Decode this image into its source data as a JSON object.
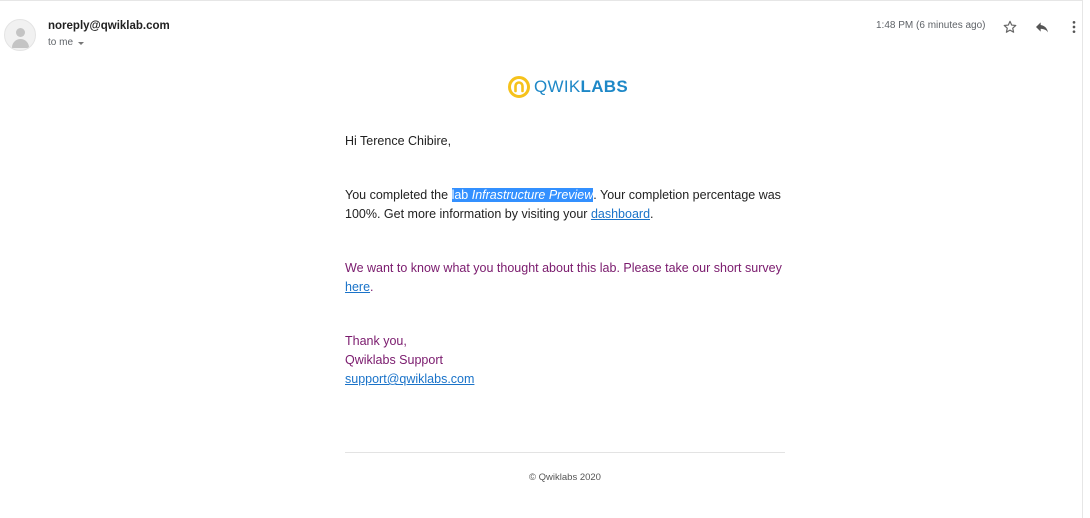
{
  "header": {
    "sender": "noreply@qwiklab.com",
    "recipient": "to me",
    "time": "1:48 PM (6 minutes ago)"
  },
  "icons": {
    "avatar": "person-avatar-icon",
    "star": "star-icon",
    "reply": "reply-icon",
    "more": "more-vert-icon",
    "logo": "qwiklabs-logo-icon"
  },
  "logo": {
    "text_light": "QWIK",
    "text_bold": "LABS"
  },
  "body": {
    "greeting": "Hi Terence Chibire,",
    "completed_prefix": "You completed the ",
    "lab_word": "lab ",
    "lab_name": "Infrastructure Preview",
    "completed_middle": ". Your completion percentage was 100%. Get more information by visiting your ",
    "dashboard_link": "dashboard",
    "completed_suffix": ".",
    "survey_text": "We want to know what you thought about this lab. Please take our short survey ",
    "survey_link": "here",
    "survey_suffix": ".",
    "thanks": "Thank you,",
    "team": "Qwiklabs Support",
    "support_email": "support@qwiklabs.com"
  },
  "footer": {
    "copyright": "© Qwiklabs 2020"
  },
  "colors": {
    "link": "#1a73c9",
    "survey_text": "#7a1a6d",
    "selection": "#3390ff",
    "logo_blue": "#1e88c7",
    "logo_yellow": "#f6c21b"
  }
}
